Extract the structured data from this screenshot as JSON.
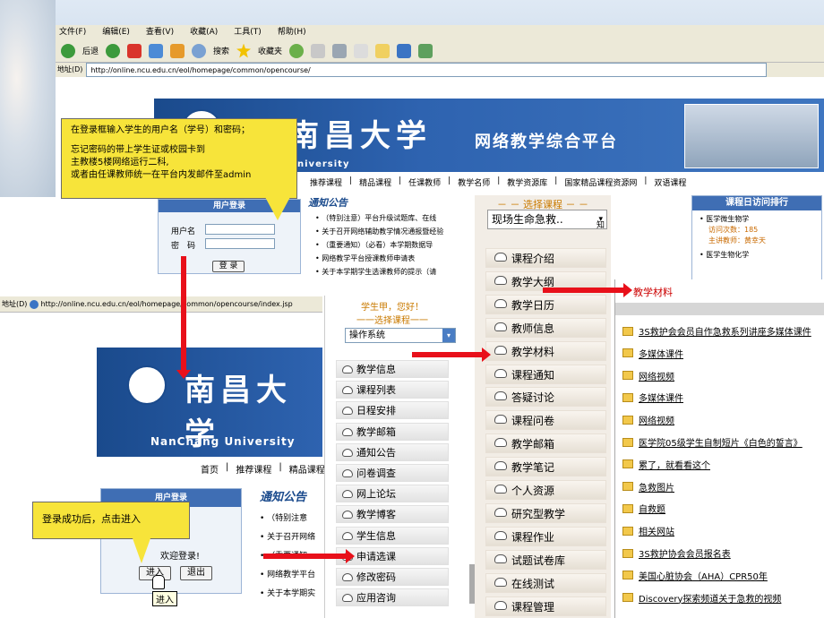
{
  "browser": {
    "menu": [
      "文件(F)",
      "编辑(E)",
      "查看(V)",
      "收藏(A)",
      "工具(T)",
      "帮助(H)"
    ],
    "toolbar": {
      "back": "后退",
      "search": "搜索",
      "favorites": "收藏夹"
    },
    "address_label": "地址(D)",
    "url1": "http://online.ncu.edu.cn/eol/homepage/common/opencourse/",
    "url2": "http://online.ncu.edu.cn/eol/homepage/common/opencourse/index.jsp"
  },
  "site": {
    "school_cn": "南昌大学",
    "school_en": "NanChang University",
    "school_en_partial": "niversity",
    "platform": "网络教学综合平台",
    "nav1": [
      "推荐课程",
      "精品课程",
      "任课教师",
      "教学名师",
      "教学资源库",
      "国家精品课程资源网",
      "双语课程"
    ],
    "nav2": [
      "首页",
      "推荐课程",
      "精品课程"
    ],
    "login_title": "用户登录",
    "username_label": "用户名",
    "password_label": "密　码",
    "login_button": "登 录",
    "notice_title": "通知公告",
    "notices1": [
      "（特别注意）平台升级试题库、在线",
      "关于召开网络辅助教学情况通报暨经验",
      "（重要通知）（必看）本学期数据导",
      "网络教学平台授课教师申请表",
      "关于本学期学生选课教师的提示（请"
    ],
    "notices2": [
      "（特别注意",
      "关于召开网络",
      "（重要通知",
      "网络教学平台",
      "关于本学期实"
    ],
    "visit_title": "课程日访问排行",
    "visit_items": [
      {
        "name": "医学微生物学",
        "count": "访问次数：185",
        "teacher": "主讲教师：黄幸天"
      },
      {
        "name": "医学生物化学"
      }
    ],
    "welcome": "欢迎登录!",
    "enter_button": "进入",
    "exit_button": "退出",
    "tooltip": "进入"
  },
  "callouts": {
    "c1": [
      "在登录框输入学生的用户名（学号）和密码；",
      "忘记密码的带上学生证或校园卡到",
      "主教楼5楼网络运行二科,",
      "或者由任课教师统一在平台内发邮件至admin"
    ],
    "c2": "登录成功后，点击进入"
  },
  "student_menu": {
    "greeting": "学生甲，您好！",
    "select_label": "一一选择课程一一",
    "selected_course": "操作系统",
    "items": [
      "教学信息",
      "课程列表",
      "日程安排",
      "教学邮箱",
      "通知公告",
      "问卷调查",
      "网上论坛",
      "教学博客",
      "学生信息",
      "申请选课",
      "修改密码",
      "应用咨询"
    ]
  },
  "course_menu": {
    "select_label": "－ － 选择课程 － －",
    "selected_course": "现场生命急救..",
    "items": [
      "课程介绍",
      "教学大纲",
      "教学日历",
      "教师信息",
      "教学材料",
      "课程通知",
      "答疑讨论",
      "课程问卷",
      "教学邮箱",
      "教学笔记",
      "个人资源",
      "研究型教学",
      "课程作业",
      "试题试卷库",
      "在线测试",
      "课程管理"
    ]
  },
  "materials": {
    "title": "教学材料",
    "items": [
      "3S救护会会员自作急救系列讲座多媒体课件",
      "多媒体课件",
      "网络视频",
      "多媒体课件",
      "网络视频",
      "医学院05级学生自制短片《白色的誓言》",
      "累了，就看看这个",
      "急救图片",
      "自救题",
      "相关网站",
      "3S救护协会会员报名表",
      "美国心脏协会（AHA）CPR50年",
      "Discovery探索频道关于急救的视频"
    ]
  },
  "colors": {
    "banner": "#1a4a8c",
    "callout": "#f7e43a",
    "arrow": "#e8101a"
  }
}
